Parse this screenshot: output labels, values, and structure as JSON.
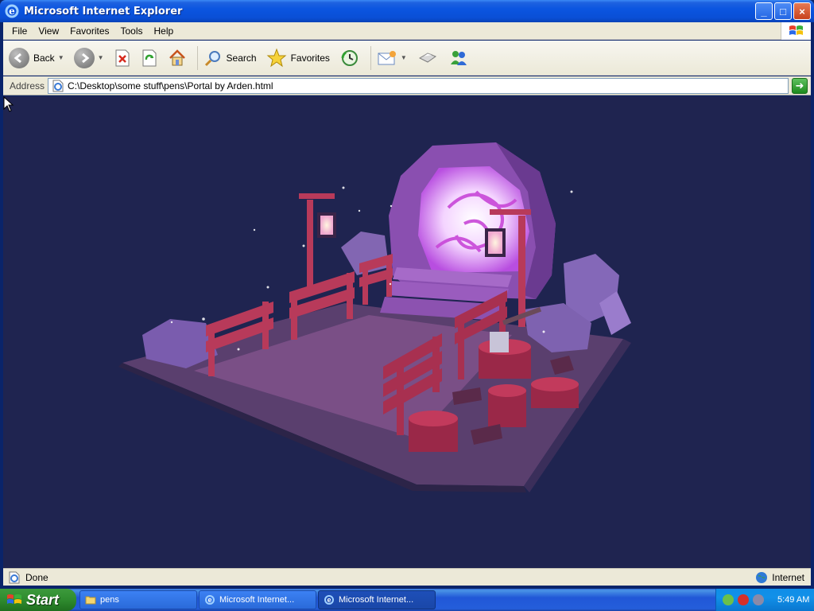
{
  "window": {
    "title": "Microsoft Internet Explorer",
    "controls": {
      "minimize": "_",
      "maximize": "□",
      "close": "×"
    }
  },
  "menubar": {
    "items": [
      "File",
      "View",
      "Favorites",
      "Tools",
      "Help"
    ]
  },
  "toolbar": {
    "back_label": "Back",
    "search_label": "Search",
    "favorites_label": "Favorites"
  },
  "address": {
    "label": "Address",
    "url": "C:\\Desktop\\some stuff\\pens\\Portal by Arden.html"
  },
  "status": {
    "text": "Done",
    "zone": "Internet"
  },
  "taskbar": {
    "start_label": "Start",
    "tasks": [
      {
        "label": "pens",
        "icon": "folder-icon"
      },
      {
        "label": "Microsoft Internet...",
        "icon": "ie-icon"
      },
      {
        "label": "Microsoft Internet...",
        "icon": "ie-icon"
      }
    ],
    "clock": "5:49 AM"
  },
  "colors": {
    "scene_background": "#1f2450",
    "portal_glow": "#f2c6ff",
    "portal_stone": "#8a4fb0",
    "fence": "#b83a5a",
    "taskbar": "#245edb",
    "start": "#2f8b2f"
  }
}
